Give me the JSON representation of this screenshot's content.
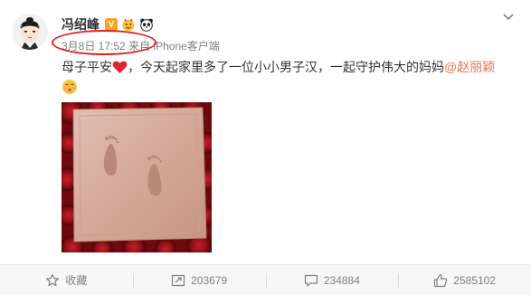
{
  "user": {
    "name": "冯绍峰",
    "verified_badge": "V"
  },
  "meta": {
    "time": "3月8日 17:52",
    "source_prefix": "来自",
    "source": "iPhone客户端"
  },
  "content": {
    "part1": "母子平安",
    "part2": "，今天起家里多了一位小小男子汉，一起守护伟大的妈妈",
    "mention": "@赵丽颖"
  },
  "actions": {
    "favorite_label": "收藏",
    "repost_count": "203679",
    "comment_count": "234884",
    "like_count": "2585102"
  },
  "colors": {
    "mention": "#eb7350",
    "highlight_ring": "#e02020",
    "verified_badge": "#f5a623",
    "heart": "#e0242b"
  },
  "icons": {
    "avatar": "cartoon-avatar",
    "badge_emoji": "emoji-icon",
    "badge_panda": "panda-icon",
    "heart": "heart-icon",
    "emoji": "emoji-icon",
    "chevron": "chevron-down-icon",
    "favorite": "star-icon",
    "repost": "repost-icon",
    "comment": "comment-icon",
    "like": "thumbs-up-icon"
  }
}
